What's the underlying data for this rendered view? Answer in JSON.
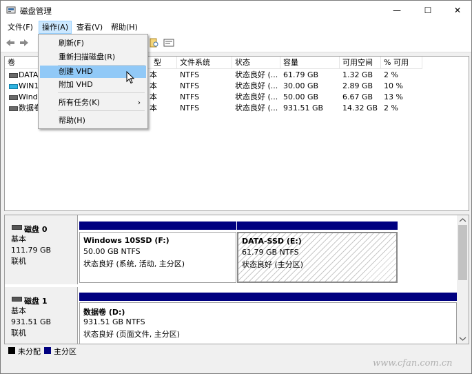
{
  "window": {
    "title": "磁盘管理",
    "minimize": "—",
    "maximize": "☐",
    "close": "✕"
  },
  "menubar": {
    "file": "文件(F)",
    "action": "操作(A)",
    "view": "查看(V)",
    "help": "帮助(H)"
  },
  "dropdown": {
    "items": [
      "刷新(F)",
      "重新扫描磁盘(R)",
      "创建 VHD",
      "附加 VHD",
      "所有任务(K)",
      "帮助(H)"
    ],
    "submenu_arrow": "›",
    "highlighted": "创建 VHD"
  },
  "volumes": {
    "headers": [
      "卷",
      "类型",
      "文件系统",
      "状态",
      "容量",
      "可用空间",
      "% 可用"
    ],
    "visible_header_fragments": {
      "type": "型"
    },
    "rows": [
      {
        "name": "DATA",
        "type": "本",
        "fs": "NTFS",
        "status": "状态良好 (...",
        "capacity": "61.79 GB",
        "free": "1.32 GB",
        "pct": "2 %",
        "icon": "drive-icon"
      },
      {
        "name": "WIN1",
        "type": "本",
        "fs": "NTFS",
        "status": "状态良好 (...",
        "capacity": "30.00 GB",
        "free": "2.89 GB",
        "pct": "10 %",
        "icon": "drive-blue-icon"
      },
      {
        "name": "Wind",
        "type": "本",
        "fs": "NTFS",
        "status": "状态良好 (...",
        "capacity": "50.00 GB",
        "free": "6.67 GB",
        "pct": "13 %",
        "icon": "drive-icon"
      },
      {
        "name": "数据卷",
        "type": "本",
        "fs": "NTFS",
        "status": "状态良好 (...",
        "capacity": "931.51 GB",
        "free": "14.32 GB",
        "pct": "2 %",
        "icon": "drive-icon"
      }
    ]
  },
  "disks": [
    {
      "title": "磁盘 0",
      "type": "基本",
      "size": "111.79 GB",
      "state": "联机",
      "partitions": [
        {
          "name": "Windows 10SSD  (F:)",
          "size_fs": "50.00 GB NTFS",
          "status": "状态良好 (系统, 活动, 主分区)"
        },
        {
          "name": "DATA-SSD  (E:)",
          "size_fs": "61.79 GB NTFS",
          "status": "状态良好 (主分区)"
        }
      ]
    },
    {
      "title": "磁盘 1",
      "type": "基本",
      "size": "931.51 GB",
      "state": "联机",
      "partitions": [
        {
          "name": "数据卷  (D:)",
          "size_fs": "931.51 GB NTFS",
          "status": "状态良好 (页面文件, 主分区)"
        }
      ]
    }
  ],
  "legend": {
    "unallocated": "未分配",
    "primary": "主分区",
    "colors": {
      "unallocated": "#000000",
      "primary": "#000080"
    }
  },
  "watermark": "www.cfan.com.cn"
}
